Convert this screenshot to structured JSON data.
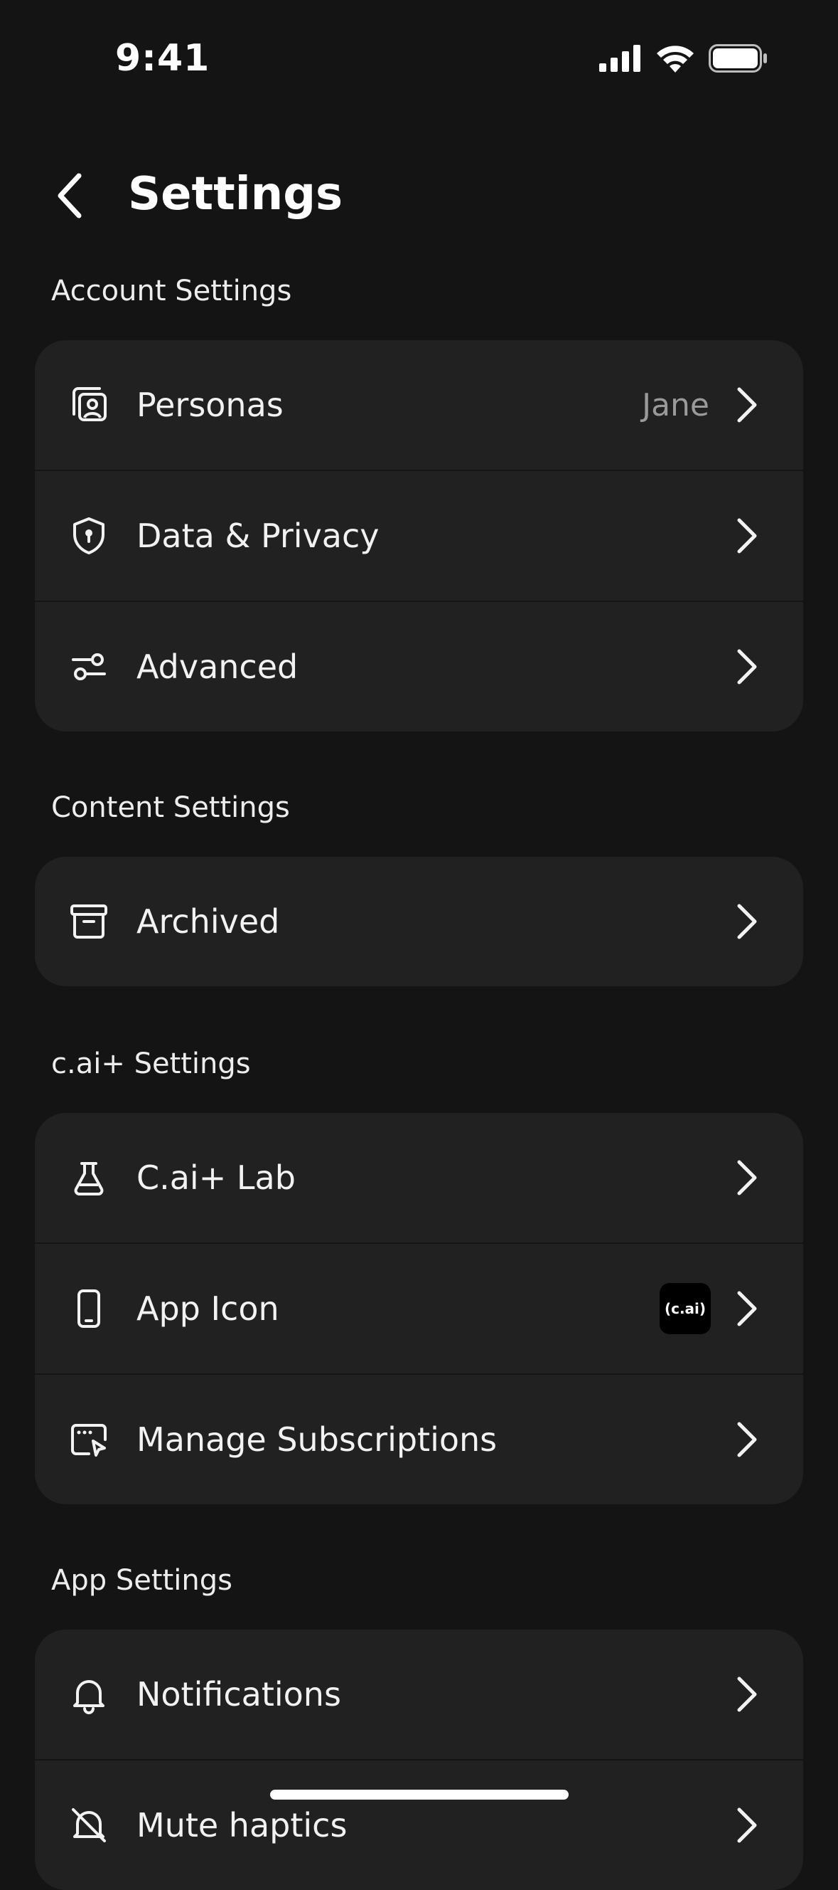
{
  "status_bar": {
    "time": "9:41"
  },
  "header": {
    "title": "Settings"
  },
  "sections": {
    "account": {
      "label": "Account Settings",
      "personas": {
        "label": "Personas",
        "value": "Jane",
        "icon": "persona-icon"
      },
      "privacy": {
        "label": "Data & Privacy",
        "icon": "shield-icon"
      },
      "advanced": {
        "label": "Advanced",
        "icon": "sliders-icon"
      }
    },
    "content": {
      "label": "Content Settings",
      "archived": {
        "label": "Archived",
        "icon": "archive-icon"
      }
    },
    "caiplus": {
      "label": "c.ai+ Settings",
      "lab": {
        "label": "C.ai+ Lab",
        "icon": "flask-icon"
      },
      "app_icon": {
        "label": "App Icon",
        "badge": "(c.ai)",
        "icon": "phone-icon"
      },
      "subscriptions": {
        "label": "Manage Subscriptions",
        "icon": "subscription-icon"
      }
    },
    "app": {
      "label": "App Settings",
      "notifications": {
        "label": "Notifications",
        "icon": "bell-icon"
      },
      "mute": {
        "label": "Mute haptics",
        "icon": "bell-off-icon"
      }
    }
  },
  "colors": {
    "background": "#141414",
    "card": "#212121",
    "text": "#f2f2f2",
    "secondary_text": "#9a9a9a"
  }
}
